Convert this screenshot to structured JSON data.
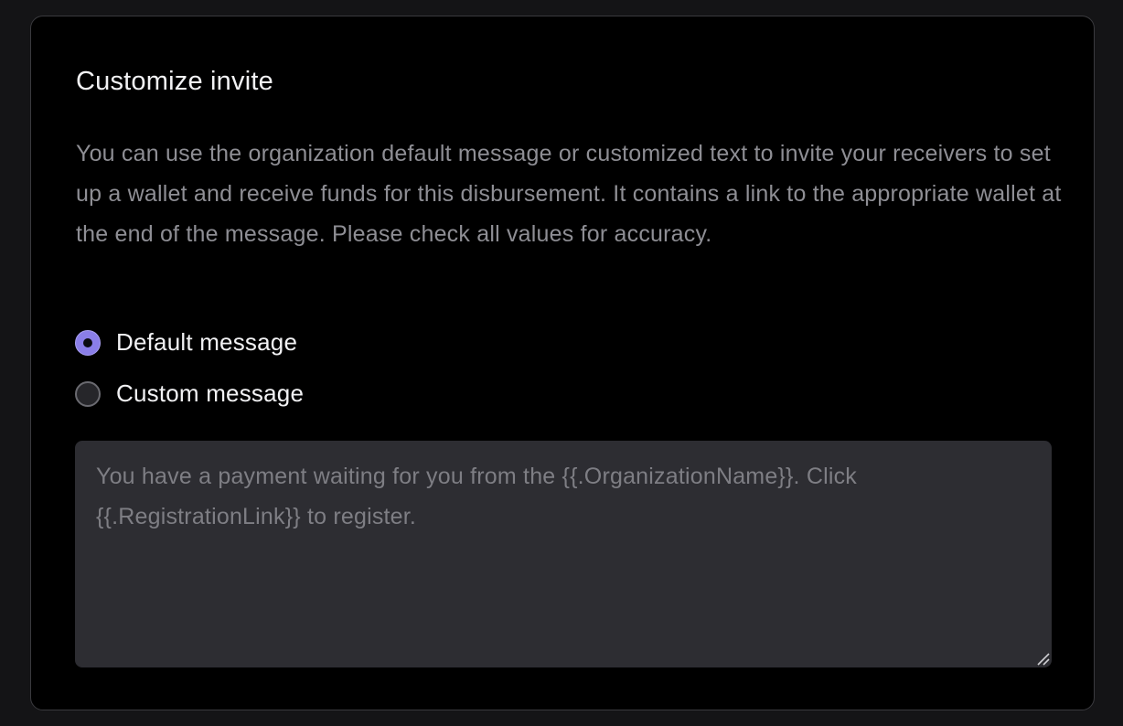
{
  "section": {
    "title": "Customize invite",
    "description": "You can use the organization default message or customized text to invite your receivers to set up a wallet and receive funds for this disbursement. It contains a link to the appropriate wallet at the end of the message. Please check all values for accuracy."
  },
  "message_options": [
    {
      "label": "Default message",
      "selected": true
    },
    {
      "label": "Custom message",
      "selected": false
    }
  ],
  "custom_message": {
    "value": "",
    "placeholder": "You have a payment waiting for you from the {{.OrganizationName}}. Click {{.RegistrationLink}} to register.",
    "disabled": true
  },
  "colors": {
    "page_background": "#141416",
    "card_background": "#000000",
    "accent": "#8a7ee8",
    "text_primary": "#f2f2f4",
    "text_secondary": "#8e8e94",
    "textarea_background": "#2d2d32"
  },
  "icons": {
    "radio_selected": "radio-selected-icon",
    "radio_unselected": "radio-unselected-icon",
    "resize": "resize-handle-icon"
  }
}
